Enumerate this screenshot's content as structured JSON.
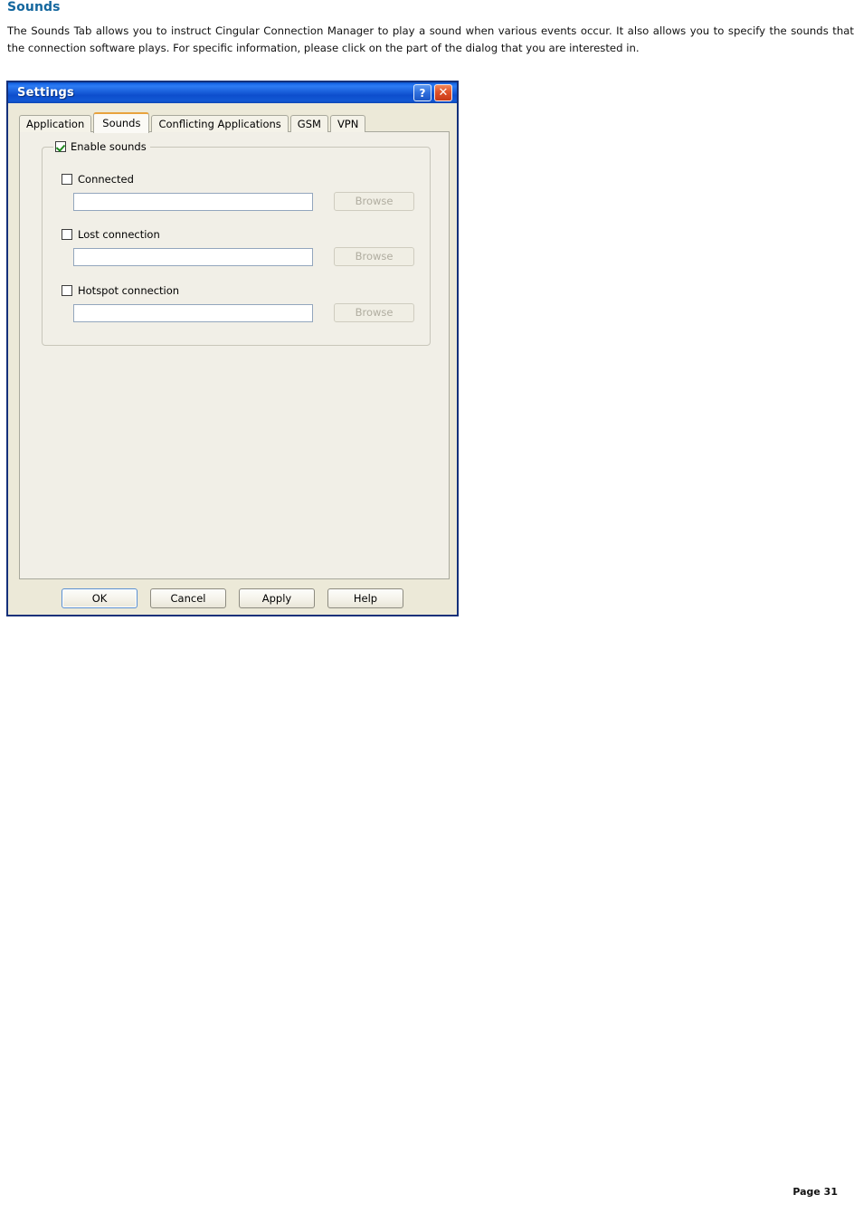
{
  "page": {
    "heading": "Sounds",
    "paragraph": "The Sounds Tab allows you to instruct Cingular Connection Manager to play a sound when various events occur. It also allows you to specify the sounds that the connection software plays. For specific information, please click on the part of the dialog that you are interested in.",
    "footer": "Page 31",
    "heading_color": "#14679e"
  },
  "dialog": {
    "title": "Settings",
    "titlebar_color": "#1d6bea",
    "help_glyph": "?",
    "close_glyph": "✕",
    "tabs": [
      {
        "label": "Application",
        "active": false
      },
      {
        "label": "Sounds",
        "active": true
      },
      {
        "label": "Conflicting Applications",
        "active": false
      },
      {
        "label": "GSM",
        "active": false
      },
      {
        "label": "VPN",
        "active": false
      }
    ],
    "active_tab_accent": "#e8a33d",
    "group": {
      "legend_label": "Enable sounds",
      "legend_checked": true,
      "rows": [
        {
          "label": "Connected",
          "checked": false,
          "value": "",
          "placeholder": "",
          "browse_label": "Browse",
          "browse_disabled": true
        },
        {
          "label": "Lost connection",
          "checked": false,
          "value": "",
          "placeholder": "",
          "browse_label": "Browse",
          "browse_disabled": true
        },
        {
          "label": "Hotspot connection",
          "checked": false,
          "value": "",
          "placeholder": "",
          "browse_label": "Browse",
          "browse_disabled": true
        }
      ]
    },
    "buttons": [
      {
        "label": "OK",
        "default": true
      },
      {
        "label": "Cancel",
        "default": false
      },
      {
        "label": "Apply",
        "default": false
      },
      {
        "label": "Help",
        "default": false
      }
    ]
  }
}
